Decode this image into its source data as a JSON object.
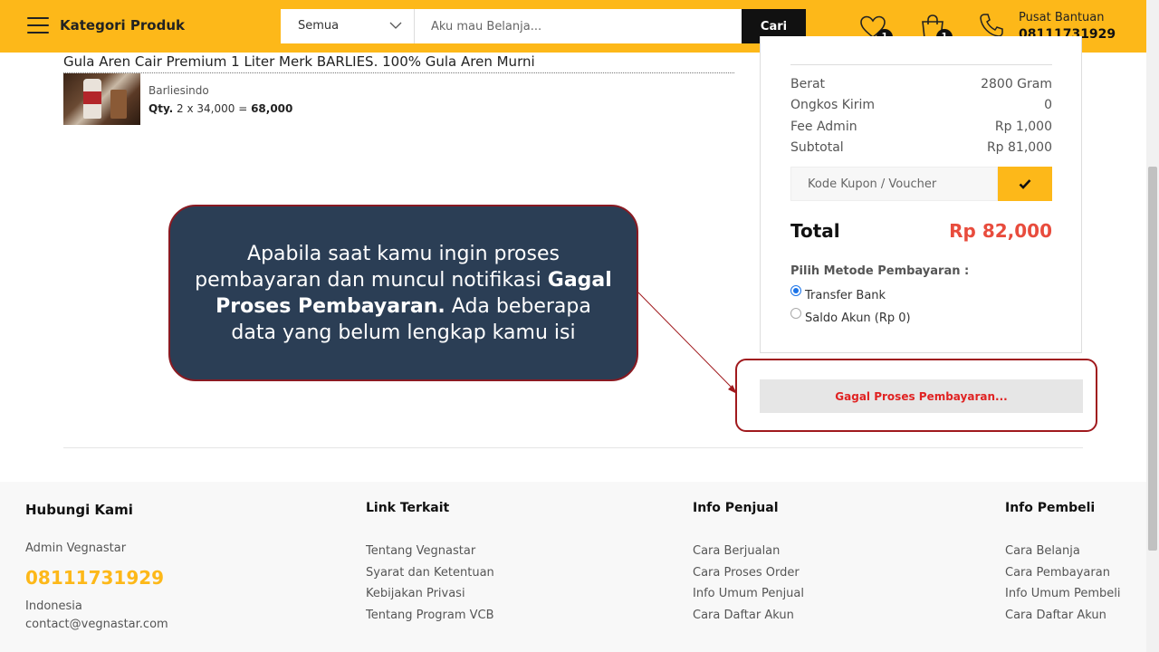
{
  "header": {
    "category_label": "Kategori Produk",
    "search_category": "Semua",
    "search_placeholder": "Aku mau Belanja...",
    "search_button": "Cari",
    "wishlist_count": "1",
    "cart_count": "1",
    "help_title": "Pusat Bantuan",
    "help_phone": "08111731929",
    "accent_color": "#fdb819"
  },
  "product": {
    "title": "Gula Aren Cair Premium 1 Liter Merk BARLIES. 100% Gula Aren Murni",
    "seller": "Barliesindo",
    "qty_label": "Qty.",
    "qty_expr": " 2 x 34,000 = ",
    "qty_total": "68,000"
  },
  "summary": {
    "rows": [
      {
        "label": "Berat",
        "value": "2800 Gram"
      },
      {
        "label": "Ongkos Kirim",
        "value": "0"
      },
      {
        "label": "Fee Admin",
        "value": "Rp 1,000"
      },
      {
        "label": "Subtotal",
        "value": "Rp 81,000"
      }
    ],
    "coupon_placeholder": "Kode Kupon / Voucher",
    "total_label": "Total",
    "total_value": "Rp 82,000",
    "payment_title": "Pilih Metode Pembayaran :",
    "payment_options": [
      {
        "label": "Transfer Bank",
        "selected": true
      },
      {
        "label": "Saldo Akun (Rp 0)",
        "selected": false
      }
    ],
    "fail_button": "Gagal Proses Pembayaran..."
  },
  "callout": {
    "text_before": "Apabila saat kamu ingin proses pembayaran dan muncul notifikasi ",
    "text_bold": "Gagal Proses Pembayaran.",
    "text_after": " Ada beberapa data yang belum lengkap kamu isi"
  },
  "footer": {
    "contact": {
      "heading": "Hubungi Kami",
      "admin": "Admin Vegnastar",
      "phone": "08111731929",
      "country": "Indonesia",
      "email": "contact@vegnastar.com"
    },
    "links": {
      "heading": "Link Terkait",
      "items": [
        "Tentang Vegnastar",
        "Syarat dan Ketentuan",
        "Kebijakan Privasi",
        "Tentang Program VCB"
      ]
    },
    "seller_info": {
      "heading": "Info Penjual",
      "items": [
        "Cara Berjualan",
        "Cara Proses Order",
        "Info Umum Penjual",
        "Cara Daftar Akun"
      ]
    },
    "buyer_info": {
      "heading": "Info Pembeli",
      "items": [
        "Cara Belanja",
        "Cara Pembayaran",
        "Info Umum Pembeli",
        "Cara Daftar Akun"
      ]
    }
  }
}
